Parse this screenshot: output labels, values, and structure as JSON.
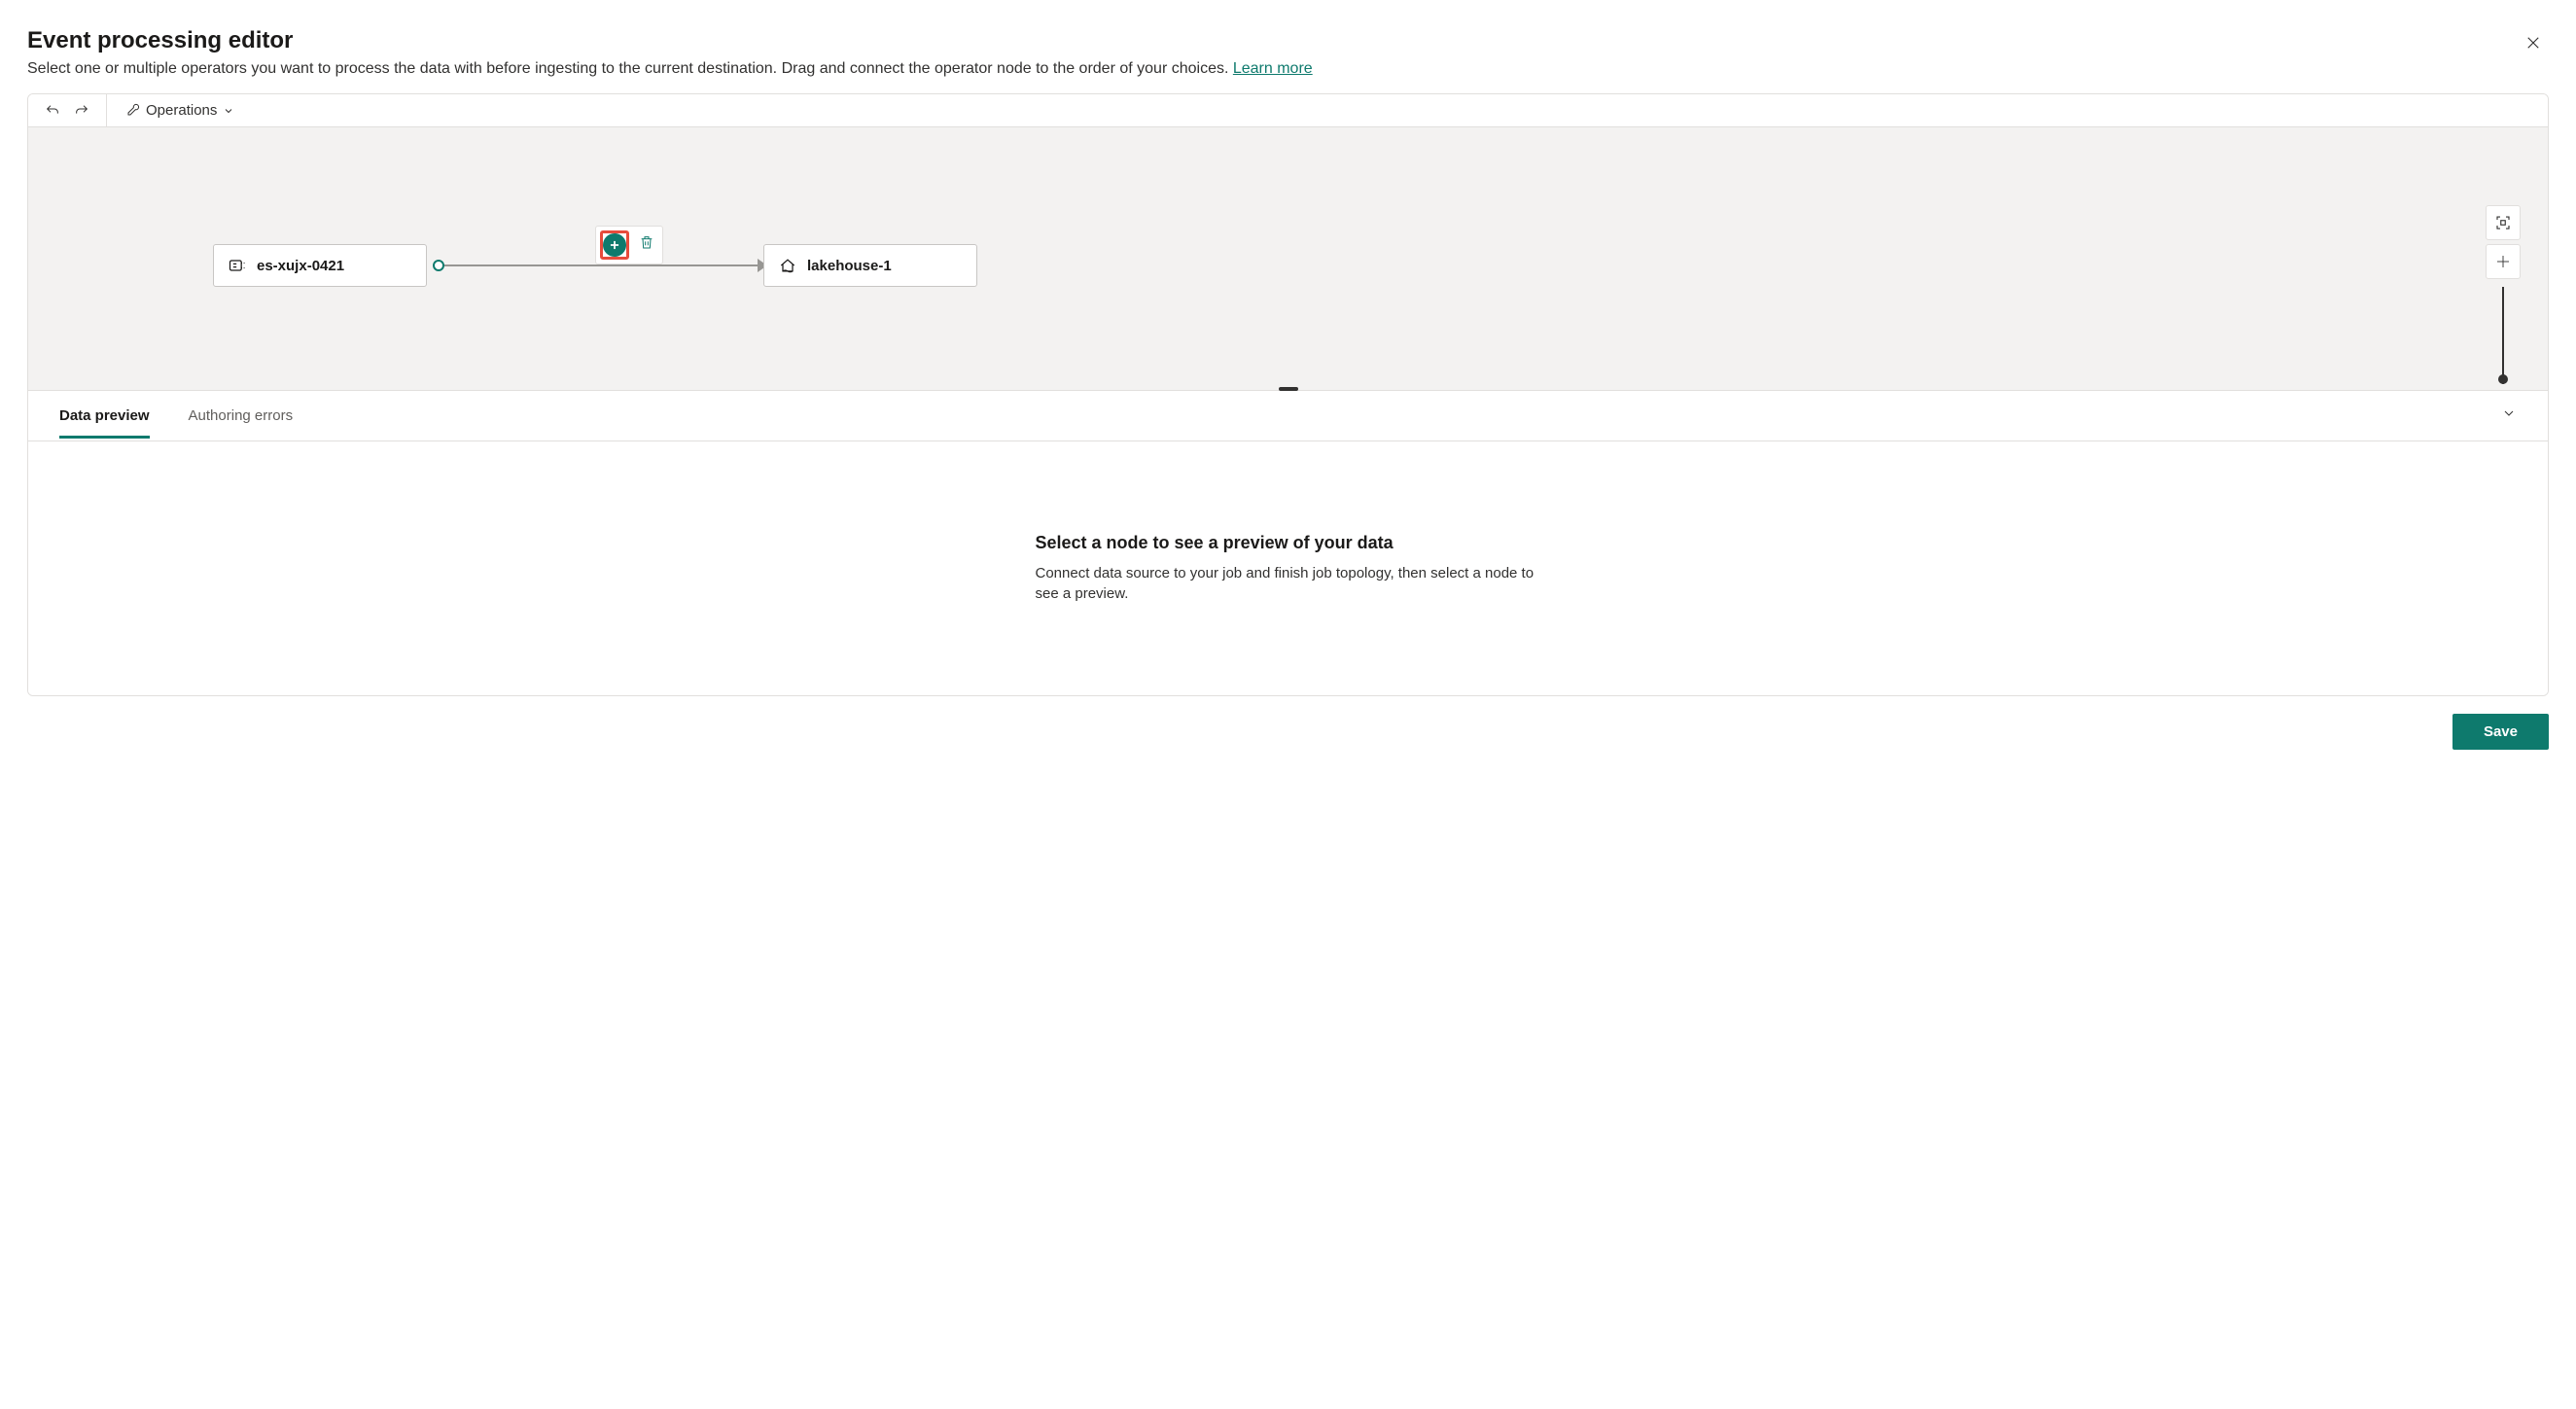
{
  "header": {
    "title": "Event processing editor",
    "subtitle_pre": "Select one or multiple operators you want to process the data with before ingesting to the current destination. Drag and connect the operator node to the order of your choices. ",
    "learn_more": "Learn more"
  },
  "toolbar": {
    "operations_label": "Operations"
  },
  "nodes": {
    "source": {
      "name": "es-xujx-0421"
    },
    "destination": {
      "name": "lakehouse-1"
    }
  },
  "bottom": {
    "tabs": {
      "preview": "Data preview",
      "errors": "Authoring errors"
    },
    "empty": {
      "title": "Select a node to see a preview of your data",
      "body": "Connect data source to your job and finish job topology, then select a node to see a preview."
    }
  },
  "footer": {
    "save": "Save"
  }
}
